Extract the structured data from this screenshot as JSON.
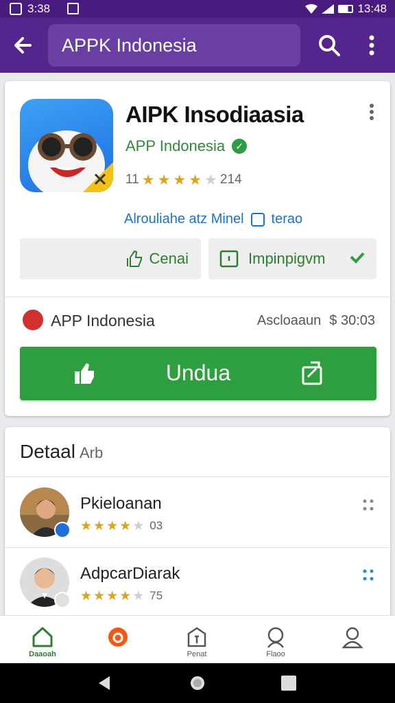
{
  "status_bar": {
    "time": "3:38",
    "clock_right": "13:48"
  },
  "search": {
    "query": "APPK Indonesia"
  },
  "app": {
    "title": "AIPK Insodiaasia",
    "developer": "APP Indonesia",
    "rating_prefix": "11",
    "rating": 4.0,
    "rating_count": "214",
    "link_text": "Alrouliahe atz Minel",
    "link_extra": "terao",
    "cancel_label": "Cenai",
    "install_label": "Impinpigvm",
    "publisher": "APP Indonesia",
    "publisher_meta": "Ascloaaun",
    "price": "$ 30:03",
    "download_label": "Undua"
  },
  "details": {
    "title": "Detaal",
    "subtitle": "Arb",
    "reviews": [
      {
        "name": "Pkieloanan",
        "rating": 3.5,
        "count": "03"
      },
      {
        "name": "AdpcarDiarak",
        "rating": 3.5,
        "count": "75"
      }
    ]
  },
  "bottom_nav": [
    {
      "label": "Daaoah",
      "icon": "home-icon"
    },
    {
      "label": "",
      "icon": "games-icon"
    },
    {
      "label": "Penat",
      "icon": "apps-icon"
    },
    {
      "label": "Flaoo",
      "icon": "search-person-icon"
    },
    {
      "label": "",
      "icon": "account-icon"
    }
  ],
  "colors": {
    "app_bar": "#55258e",
    "accent_green": "#2e9f3e",
    "link_blue": "#1a73c8",
    "star": "#d9a520"
  }
}
